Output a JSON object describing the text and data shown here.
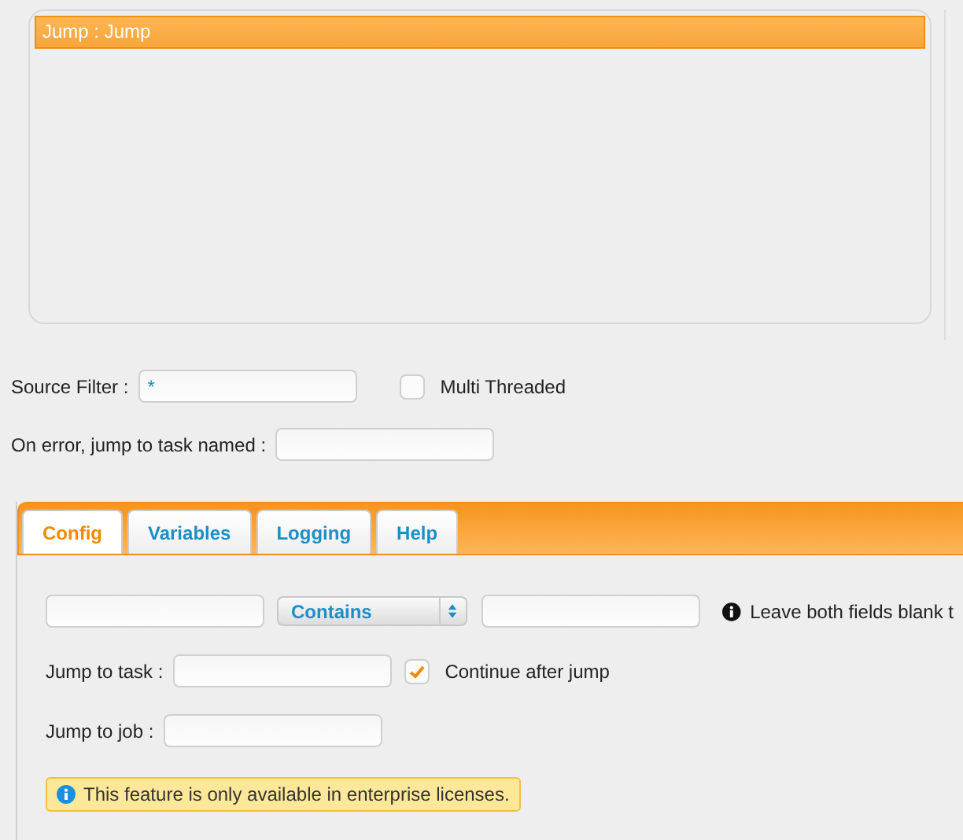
{
  "task_list": {
    "items": [
      {
        "label": "Jump : Jump",
        "selected": true
      }
    ]
  },
  "source_filter": {
    "label": "Source Filter :",
    "value": "*"
  },
  "multi_threaded": {
    "label": "Multi Threaded",
    "checked": false
  },
  "on_error": {
    "label": "On error, jump to task named :"
  },
  "tabs": [
    {
      "label": "Config",
      "selected": true
    },
    {
      "label": "Variables",
      "selected": false
    },
    {
      "label": "Logging",
      "selected": false
    },
    {
      "label": "Help",
      "selected": false
    }
  ],
  "config": {
    "operator": "Contains",
    "hint": "Leave both fields blank t",
    "jump_to_task": {
      "label": "Jump to task :"
    },
    "continue_after_jump": {
      "label": "Continue after jump",
      "checked": true
    },
    "jump_to_job": {
      "label": "Jump to job :"
    },
    "notice": "This feature is only available in enterprise licenses."
  }
}
